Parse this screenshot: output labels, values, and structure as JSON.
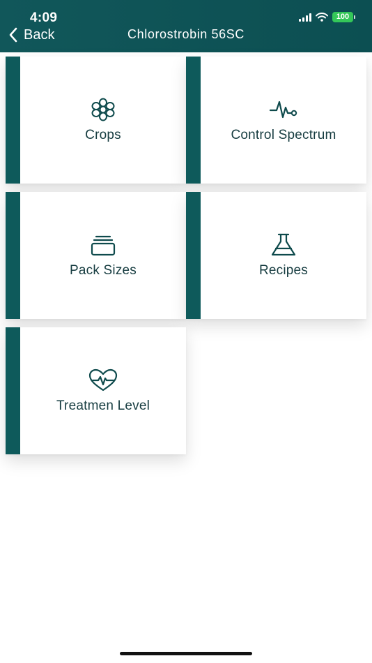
{
  "status_bar": {
    "time": "4:09",
    "battery": "100",
    "icons": [
      "cellular-signal-icon",
      "wifi-icon",
      "battery-icon"
    ]
  },
  "nav": {
    "back_label": "Back",
    "title": "Chlorostrobin 56SC",
    "background": "#0e5558"
  },
  "menu": {
    "accent": "#0e5a5b",
    "items": [
      {
        "label": "Crops",
        "icon": "flower-icon"
      },
      {
        "label": "Control Spectrum",
        "icon": "pulse-icon"
      },
      {
        "label": "Pack Sizes",
        "icon": "package-icon"
      },
      {
        "label": "Recipes",
        "icon": "flask-icon"
      },
      {
        "label": "Treatmen Level",
        "icon": "heart-pulse-icon"
      }
    ]
  }
}
